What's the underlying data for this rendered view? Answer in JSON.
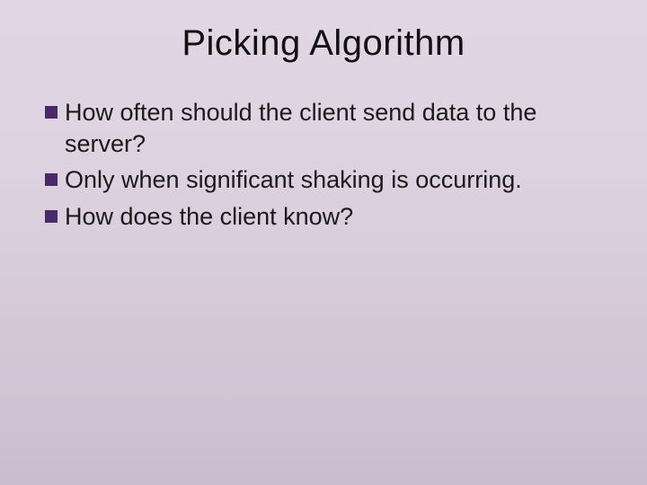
{
  "slide": {
    "title": "Picking Algorithm",
    "bullets": [
      "How often should the client send data to the server?",
      "Only when significant shaking is occurring.",
      "How does the client know?"
    ],
    "bullet_color": "#4a2a66"
  }
}
